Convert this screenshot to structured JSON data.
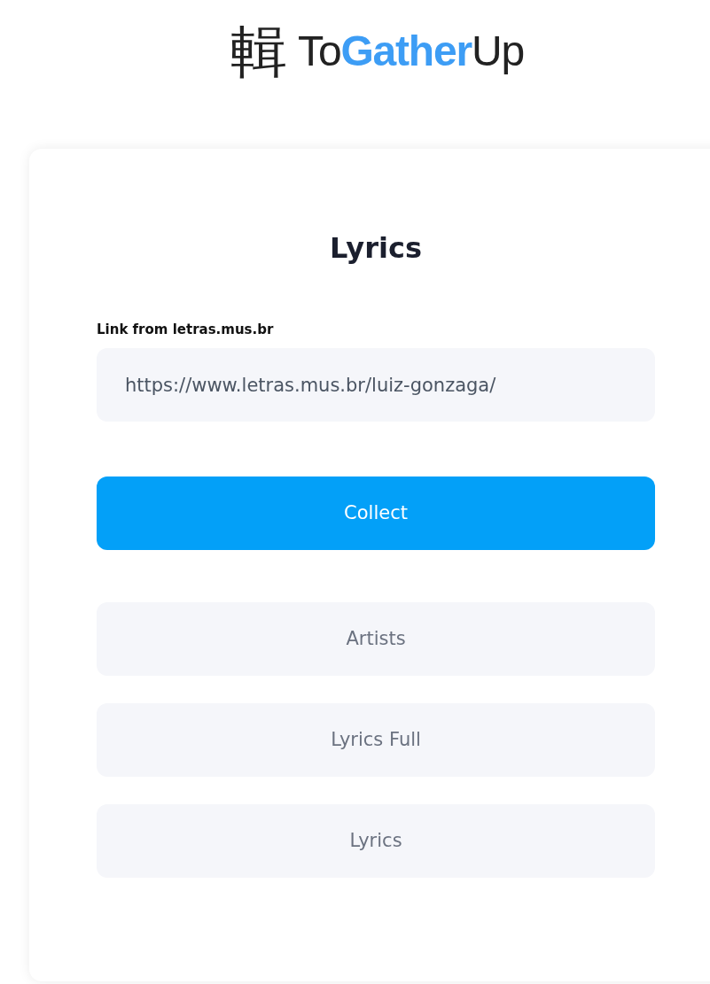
{
  "logo": {
    "glyph": "輯",
    "parts": [
      {
        "text": "To",
        "accent": false
      },
      {
        "text": "Gather",
        "accent": true
      },
      {
        "text": "Up",
        "accent": false
      }
    ]
  },
  "card": {
    "title": "Lyrics",
    "field": {
      "label": "Link from letras.mus.br",
      "value": "https://www.letras.mus.br/luiz-gonzaga/"
    },
    "buttons": [
      {
        "label": "Collect",
        "kind": "primary"
      },
      {
        "label": "Artists",
        "kind": "secondary"
      },
      {
        "label": "Lyrics Full",
        "kind": "secondary"
      },
      {
        "label": "Lyrics",
        "kind": "secondary"
      }
    ]
  }
}
